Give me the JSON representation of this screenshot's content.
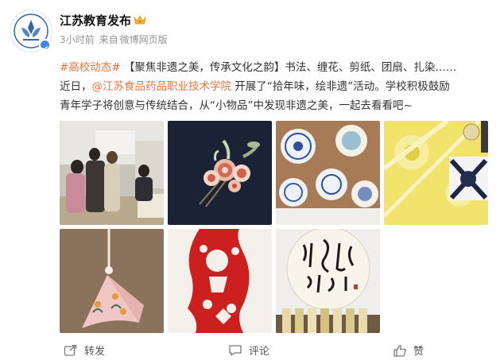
{
  "post": {
    "author": "江苏教育发布",
    "time": "3小时前",
    "source_prefix": "来自",
    "source": "微博网页版",
    "text": {
      "hashtag": "#高校动态#",
      "title": "【聚焦非遗之美，传承文化之韵】",
      "line1_rest": "书法、缠花、剪纸、团扇、扎染……",
      "line2_prefix": "近日，",
      "mention": "@江苏食品药品职业技术学院",
      "line2_rest": " 开展了“拾年味，绘非遗”活动。学校积极鼓励",
      "line3": "青年学子将创意与传统结合，从“小物品”中发现非遗之美，一起去看看吧~"
    },
    "images": [
      {
        "icon": "photo-students-viewing"
      },
      {
        "icon": "photo-chanhua-hairpin"
      },
      {
        "icon": "photo-blue-white-fans"
      },
      {
        "icon": "photo-tie-dye"
      },
      {
        "icon": "photo-sachet"
      },
      {
        "icon": "photo-papercut"
      },
      {
        "icon": "photo-calligraphy"
      }
    ]
  },
  "actions": {
    "repost": "转发",
    "comment": "评论",
    "like": "赞"
  },
  "colors": {
    "link": "#eb7340",
    "meta": "#939393",
    "brand_blue": "#3b86e6"
  }
}
